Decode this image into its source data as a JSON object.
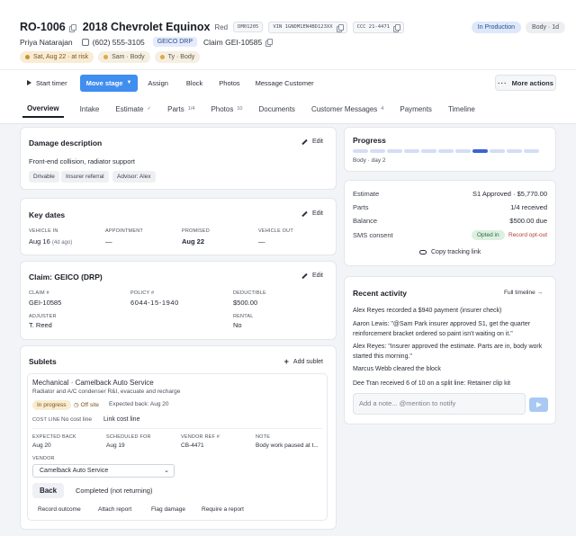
{
  "header": {
    "ro_number": "RO-1006",
    "vehicle": "2018 Chevrolet Equinox",
    "color": "Red",
    "plate": "DM01205",
    "vin_label": "VIN 1GNDM1EN4BD123XX",
    "ccc_label": "CCC 21-4471",
    "status_badge": "In Production",
    "body_badge": "Body · 1d",
    "customer_name": "Priya Natarajan",
    "phone": "(602) 555-3105",
    "insurer": "GEICO DRP",
    "claim": "Claim GEI-10585",
    "pills": [
      {
        "label": "Sat, Aug 22 · at risk"
      },
      {
        "label": "Sam · Body"
      },
      {
        "label": "Ty · Body"
      }
    ]
  },
  "toolbar": {
    "start_timer": "Start timer",
    "move_stage": "Move stage",
    "assign": "Assign",
    "block": "Block",
    "photos": "Photos",
    "message_customer": "Message Customer",
    "more_actions": "More actions"
  },
  "tabs": [
    {
      "label": "Overview",
      "count": ""
    },
    {
      "label": "Intake",
      "count": ""
    },
    {
      "label": "Estimate",
      "count": "✓"
    },
    {
      "label": "Parts",
      "count": "1/4"
    },
    {
      "label": "Photos",
      "count": "10"
    },
    {
      "label": "Documents",
      "count": ""
    },
    {
      "label": "Customer Messages",
      "count": "4"
    },
    {
      "label": "Payments",
      "count": ""
    },
    {
      "label": "Timeline",
      "count": ""
    }
  ],
  "damage": {
    "title": "Damage description",
    "edit": "Edit",
    "text": "Front-end collision, radiator support",
    "tags": [
      "Drivable",
      "Insurer referral",
      "Advisor: Alex"
    ]
  },
  "key_dates": {
    "title": "Key dates",
    "edit": "Edit",
    "vehicle_in_label": "VEHICLE IN",
    "vehicle_in": "Aug 16",
    "vehicle_in_ago": "(4d ago)",
    "appointment_label": "APPOINTMENT",
    "appointment": "—",
    "promised_label": "PROMISED",
    "promised": "Aug 22",
    "vehicle_out_label": "VEHICLE OUT",
    "vehicle_out": "—"
  },
  "claim_card": {
    "title": "Claim: GEICO (DRP)",
    "edit": "Edit",
    "claim_label": "CLAIM #",
    "claim": "GEI-10585",
    "policy_label": "POLICY #",
    "policy": "6044-15-1940",
    "deductible_label": "DEDUCTIBLE",
    "deductible": "$500.00",
    "adjuster_label": "ADJUSTER",
    "adjuster": "T. Reed",
    "rental_label": "RENTAL",
    "rental": "No"
  },
  "sublets": {
    "title": "Sublets",
    "add": "Add sublet",
    "item_title": "Mechanical · Camelback Auto Service",
    "item_desc": "Radiator and A/C condenser R&I, evacuate and recharge",
    "status": "In progress",
    "offsite": "Off site",
    "expected_back_inline": "Expected back: Aug 20",
    "cost_line_label": "COST LINE",
    "cost_line_value": "No cost line",
    "link_cost_line": "Link cost line",
    "expected_back_label": "EXPECTED BACK",
    "expected_back": "Aug 20",
    "scheduled_label": "SCHEDULED FOR",
    "scheduled": "Aug 19",
    "vendor_ref_label": "VENDOR REF #",
    "vendor_ref": "CB-4471",
    "note_label": "NOTE",
    "note": "Body work paused at t...",
    "vendor_label": "VENDOR",
    "vendor_selected": "Camelback Auto Service",
    "back_btn": "Back",
    "completed_btn": "Completed (not returning)",
    "actions": [
      "Record outcome",
      "Attach report",
      "Flag damage",
      "Require a report"
    ]
  },
  "progress": {
    "title": "Progress",
    "total_segments": 11,
    "active_segment": 8,
    "caption": "Body · day 2"
  },
  "summary": {
    "estimate_label": "Estimate",
    "estimate": "S1 Approved · $5,770.00",
    "parts_label": "Parts",
    "parts": "1/4 received",
    "balance_label": "Balance",
    "balance": "$500.00 due",
    "sms_label": "SMS consent",
    "sms_status": "Opted in",
    "sms_action": "Record opt-out",
    "copy_link": "Copy tracking link"
  },
  "activity": {
    "title": "Recent activity",
    "full_timeline": "Full timeline →",
    "items": [
      "Alex Reyes recorded a $940 payment (insurer check)",
      "Aaron Lewis: \"@Sam Park insurer approved S1, get the quarter reinforcement bracket ordered so paint isn't waiting on it.\"",
      "Alex Reyes: \"Insurer approved the estimate. Parts are in, body work started this morning.\"",
      "Marcus Webb cleared the block",
      "Dee Tran received 6 of 10 on a split line: Retainer clip kit"
    ],
    "note_placeholder": "Add a note... @mention to notify"
  },
  "colors": {
    "accent": "#3f8ef0",
    "progress_active": "#3a63d2",
    "risk_pill": "#f9ecd4"
  }
}
